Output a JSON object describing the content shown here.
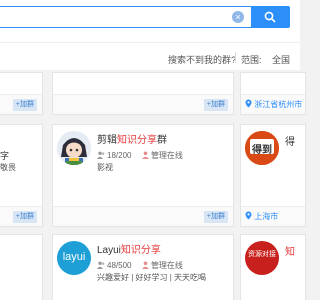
{
  "search": {
    "value": "",
    "placeholder": ""
  },
  "filter": {
    "not_found_link": "搜索不到我的群?",
    "range_label": "范围:",
    "range_value": "全国"
  },
  "add_label": "+加群",
  "top_row": {
    "location": "浙江省杭州市"
  },
  "mid_left": {
    "line1": "字",
    "line2": "敬畏"
  },
  "mid_center": {
    "name_prefix": "剪辑",
    "name_highlight": "知识分享",
    "name_suffix": "群",
    "members": "18/200",
    "admin": "管理在线",
    "tags": "影视"
  },
  "mid_right": {
    "logo_text": "得到",
    "name_start": "得",
    "location": "上海市"
  },
  "bottom_center": {
    "name_prefix": "Layui",
    "name_highlight": "知识分享",
    "members": "48/500",
    "admin": "管理在线",
    "tags": "兴趣爱好 | 好好学习 | 天天吃喝",
    "logo_text": "layui"
  },
  "bottom_right": {
    "name_start": "知",
    "logo_text": "资源对接"
  },
  "colors": {
    "accent": "#2c8ef8",
    "highlight": "#e4393c"
  }
}
